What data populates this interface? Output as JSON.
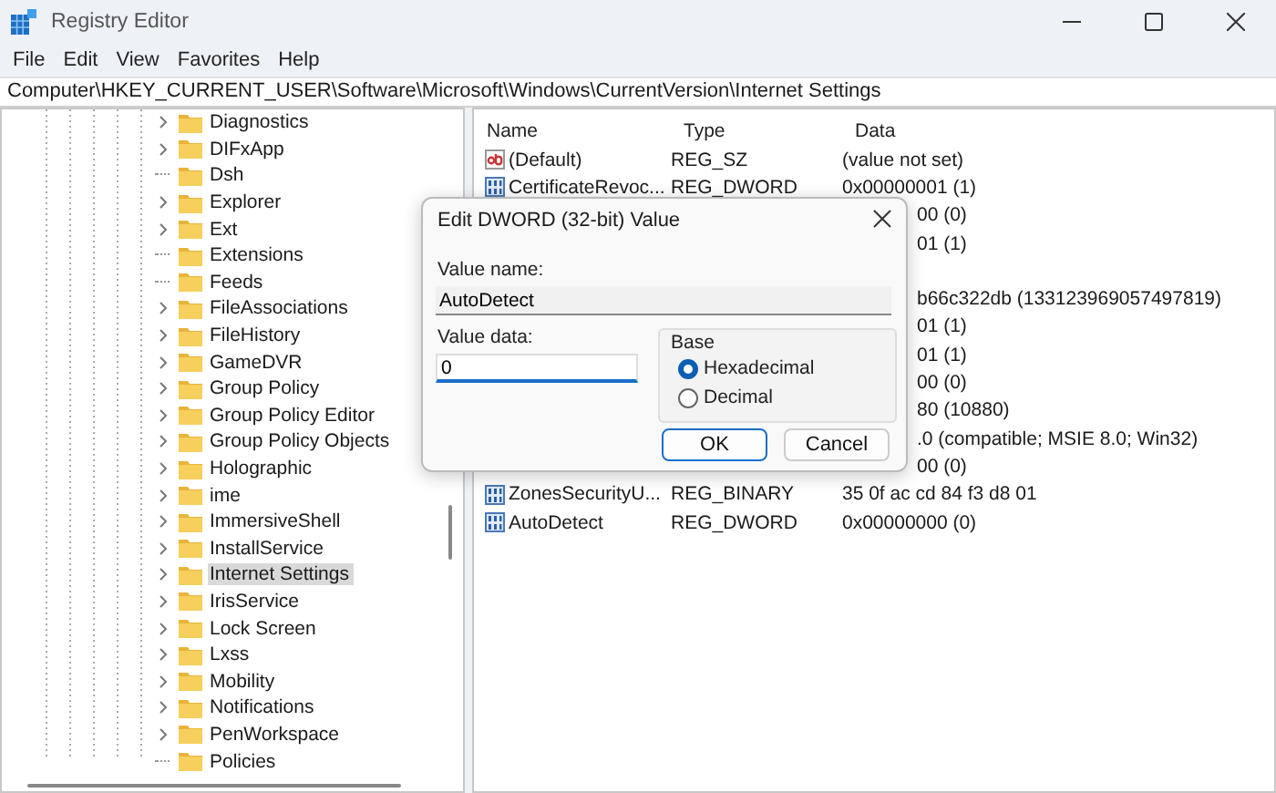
{
  "window": {
    "title": "Registry Editor"
  },
  "menu": [
    "File",
    "Edit",
    "View",
    "Favorites",
    "Help"
  ],
  "address": "Computer\\HKEY_CURRENT_USER\\Software\\Microsoft\\Windows\\CurrentVersion\\Internet Settings",
  "tree": [
    {
      "label": "Diagnostics",
      "expandable": true,
      "selected": false
    },
    {
      "label": "DIFxApp",
      "expandable": true,
      "selected": false
    },
    {
      "label": "Dsh",
      "expandable": false,
      "selected": false
    },
    {
      "label": "Explorer",
      "expandable": true,
      "selected": false
    },
    {
      "label": "Ext",
      "expandable": true,
      "selected": false
    },
    {
      "label": "Extensions",
      "expandable": false,
      "selected": false
    },
    {
      "label": "Feeds",
      "expandable": false,
      "selected": false
    },
    {
      "label": "FileAssociations",
      "expandable": true,
      "selected": false
    },
    {
      "label": "FileHistory",
      "expandable": true,
      "selected": false
    },
    {
      "label": "GameDVR",
      "expandable": true,
      "selected": false
    },
    {
      "label": "Group Policy",
      "expandable": true,
      "selected": false
    },
    {
      "label": "Group Policy Editor",
      "expandable": true,
      "selected": false
    },
    {
      "label": "Group Policy Objects",
      "expandable": true,
      "selected": false
    },
    {
      "label": "Holographic",
      "expandable": true,
      "selected": false
    },
    {
      "label": "ime",
      "expandable": true,
      "selected": false
    },
    {
      "label": "ImmersiveShell",
      "expandable": true,
      "selected": false
    },
    {
      "label": "InstallService",
      "expandable": true,
      "selected": false
    },
    {
      "label": "Internet Settings",
      "expandable": true,
      "selected": true
    },
    {
      "label": "IrisService",
      "expandable": true,
      "selected": false
    },
    {
      "label": "Lock Screen",
      "expandable": true,
      "selected": false
    },
    {
      "label": "Lxss",
      "expandable": true,
      "selected": false
    },
    {
      "label": "Mobility",
      "expandable": true,
      "selected": false
    },
    {
      "label": "Notifications",
      "expandable": true,
      "selected": false
    },
    {
      "label": "PenWorkspace",
      "expandable": true,
      "selected": false
    },
    {
      "label": "Policies",
      "expandable": false,
      "selected": false
    }
  ],
  "values": {
    "columns": [
      "Name",
      "Type",
      "Data"
    ],
    "rows": [
      {
        "kind": "string",
        "name": "(Default)",
        "type": "REG_SZ",
        "data": "(value not set)"
      },
      {
        "kind": "binary",
        "name": "CertificateRevoc...",
        "type": "REG_DWORD",
        "data": "0x00000001 (1)"
      },
      {
        "kind": "covered",
        "data": "00 (0)"
      },
      {
        "kind": "covered",
        "data": "01 (1)"
      },
      {
        "kind": "covered"
      },
      {
        "kind": "covered",
        "data": "b66c322db (133123969057497819)"
      },
      {
        "kind": "covered",
        "data": "01 (1)"
      },
      {
        "kind": "covered",
        "data": "01 (1)"
      },
      {
        "kind": "covered",
        "data": "00 (0)"
      },
      {
        "kind": "covered",
        "data": "80 (10880)"
      },
      {
        "kind": "covered",
        "data": ".0 (compatible; MSIE 8.0; Win32)"
      },
      {
        "kind": "covered",
        "data": "00 (0)"
      },
      {
        "kind": "binary",
        "name": "ZonesSecurityU...",
        "type": "REG_BINARY",
        "data": "35 0f ac cd 84 f3 d8 01"
      },
      {
        "kind": "binary",
        "name": "AutoDetect",
        "type": "REG_DWORD",
        "data": "0x00000000 (0)"
      }
    ]
  },
  "dialog": {
    "title": "Edit DWORD (32-bit) Value",
    "value_name_label": "Value name:",
    "value_name": "AutoDetect",
    "value_data_label": "Value data:",
    "value_data": "0",
    "base_label": "Base",
    "bases": [
      {
        "label": "Hexadecimal",
        "selected": true
      },
      {
        "label": "Decimal",
        "selected": false
      }
    ],
    "buttons": [
      {
        "label": "OK",
        "default": true
      },
      {
        "label": "Cancel",
        "default": false
      }
    ]
  }
}
